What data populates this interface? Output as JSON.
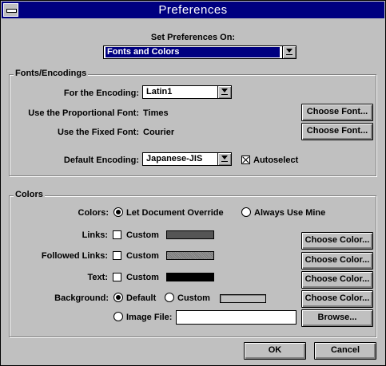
{
  "window": {
    "title": "Preferences"
  },
  "header": {
    "label": "Set Preferences On:",
    "selected": "Fonts and Colors"
  },
  "fonts_group": {
    "title": "Fonts/Encodings",
    "encoding_label": "For the Encoding:",
    "encoding_value": "Latin1",
    "prop_font_label": "Use the Proportional Font:",
    "prop_font_value": "Times",
    "fixed_font_label": "Use the Fixed Font:",
    "fixed_font_value": "Courier",
    "choose_font_label": "Choose Font...",
    "default_encoding_label": "Default Encoding:",
    "default_encoding_value": "Japanese-JIS",
    "autoselect_label": "Autoselect",
    "autoselect_checked": true
  },
  "colors_group": {
    "title": "Colors",
    "colors_label": "Colors:",
    "override_label": "Let Document Override",
    "always_label": "Always Use Mine",
    "custom_label": "Custom",
    "choose_color_label": "Choose Color...",
    "links_label": "Links:",
    "followed_label": "Followed Links:",
    "text_label": "Text:",
    "background_label": "Background:",
    "default_label": "Default",
    "image_file_label": "Image File:",
    "image_file_value": "",
    "browse_label": "Browse...",
    "swatch_colors": {
      "links": "#555555",
      "followed": "#8a8a8a",
      "text": "#000000",
      "background": "#c0c0c0"
    }
  },
  "footer": {
    "ok_label": "OK",
    "cancel_label": "Cancel"
  }
}
